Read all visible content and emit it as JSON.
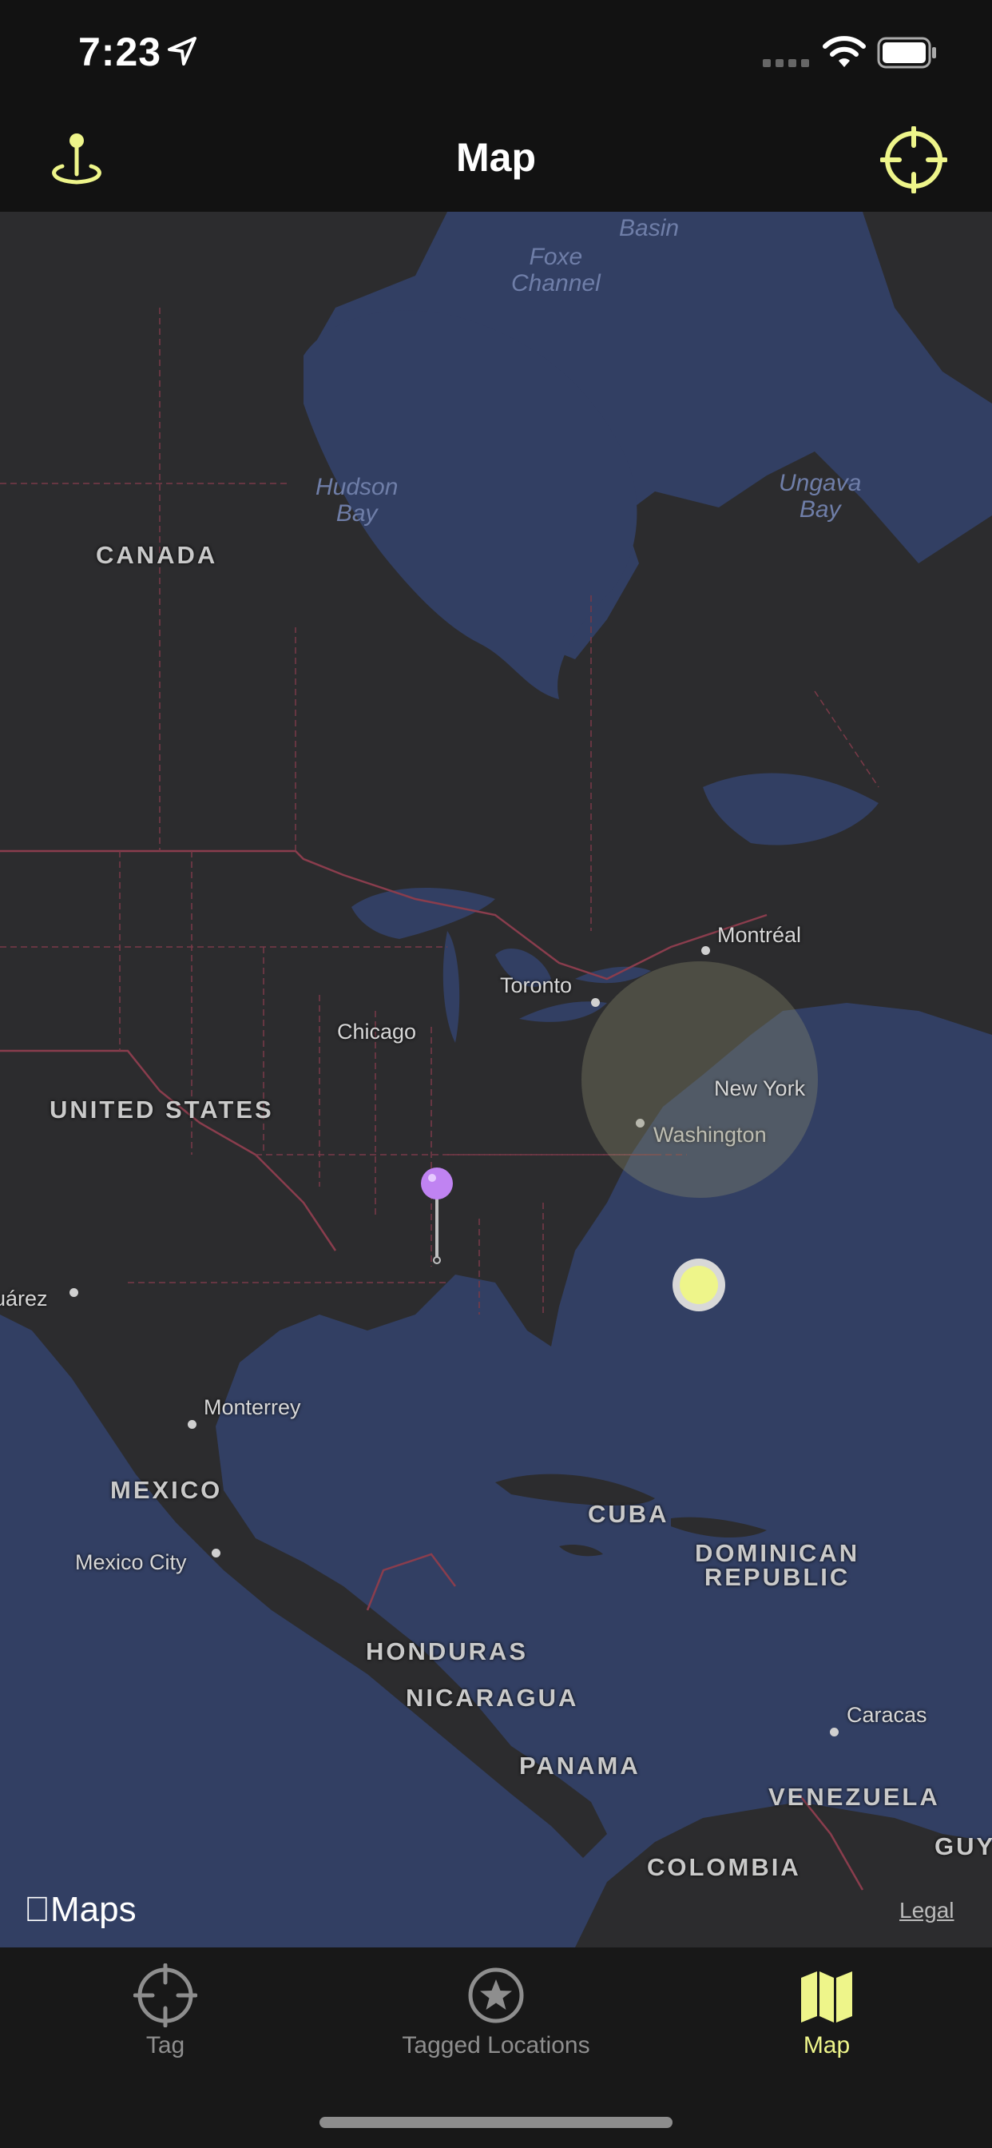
{
  "status_bar": {
    "time": "7:23",
    "icons": [
      "location-arrow-icon",
      "signal-icon",
      "wifi-icon",
      "battery-icon"
    ]
  },
  "nav": {
    "title": "Map",
    "left_icon": "pin-on-ground-icon",
    "right_icon": "crosshair-icon",
    "accent_color": "#eef58a"
  },
  "map": {
    "water_labels": [
      {
        "text": "Foxe\nChannel"
      },
      {
        "text": "Basin"
      },
      {
        "text": "Hudson\nBay"
      },
      {
        "text": "Ungava\nBay"
      }
    ],
    "country_labels": [
      "CANADA",
      "UNITED STATES",
      "MEXICO",
      "CUBA",
      "DOMINICAN\nREPUBLIC",
      "HONDURAS",
      "NICARAGUA",
      "PANAMA",
      "VENEZUELA",
      "COLOMBIA",
      "GUY"
    ],
    "city_labels": [
      "Montréal",
      "Toronto",
      "Chicago",
      "New York",
      "Washington",
      "Juárez",
      "Monterrey",
      "Mexico City",
      "Caracas"
    ],
    "pin_color": "#c083f2",
    "user_location_color": "#eef58a",
    "attribution": "Maps",
    "legal": "Legal"
  },
  "tabs": [
    {
      "label": "Tag",
      "icon": "crosshair-icon",
      "active": false
    },
    {
      "label": "Tagged Locations",
      "icon": "star-circle-icon",
      "active": false
    },
    {
      "label": "Map",
      "icon": "map-icon",
      "active": true
    }
  ]
}
